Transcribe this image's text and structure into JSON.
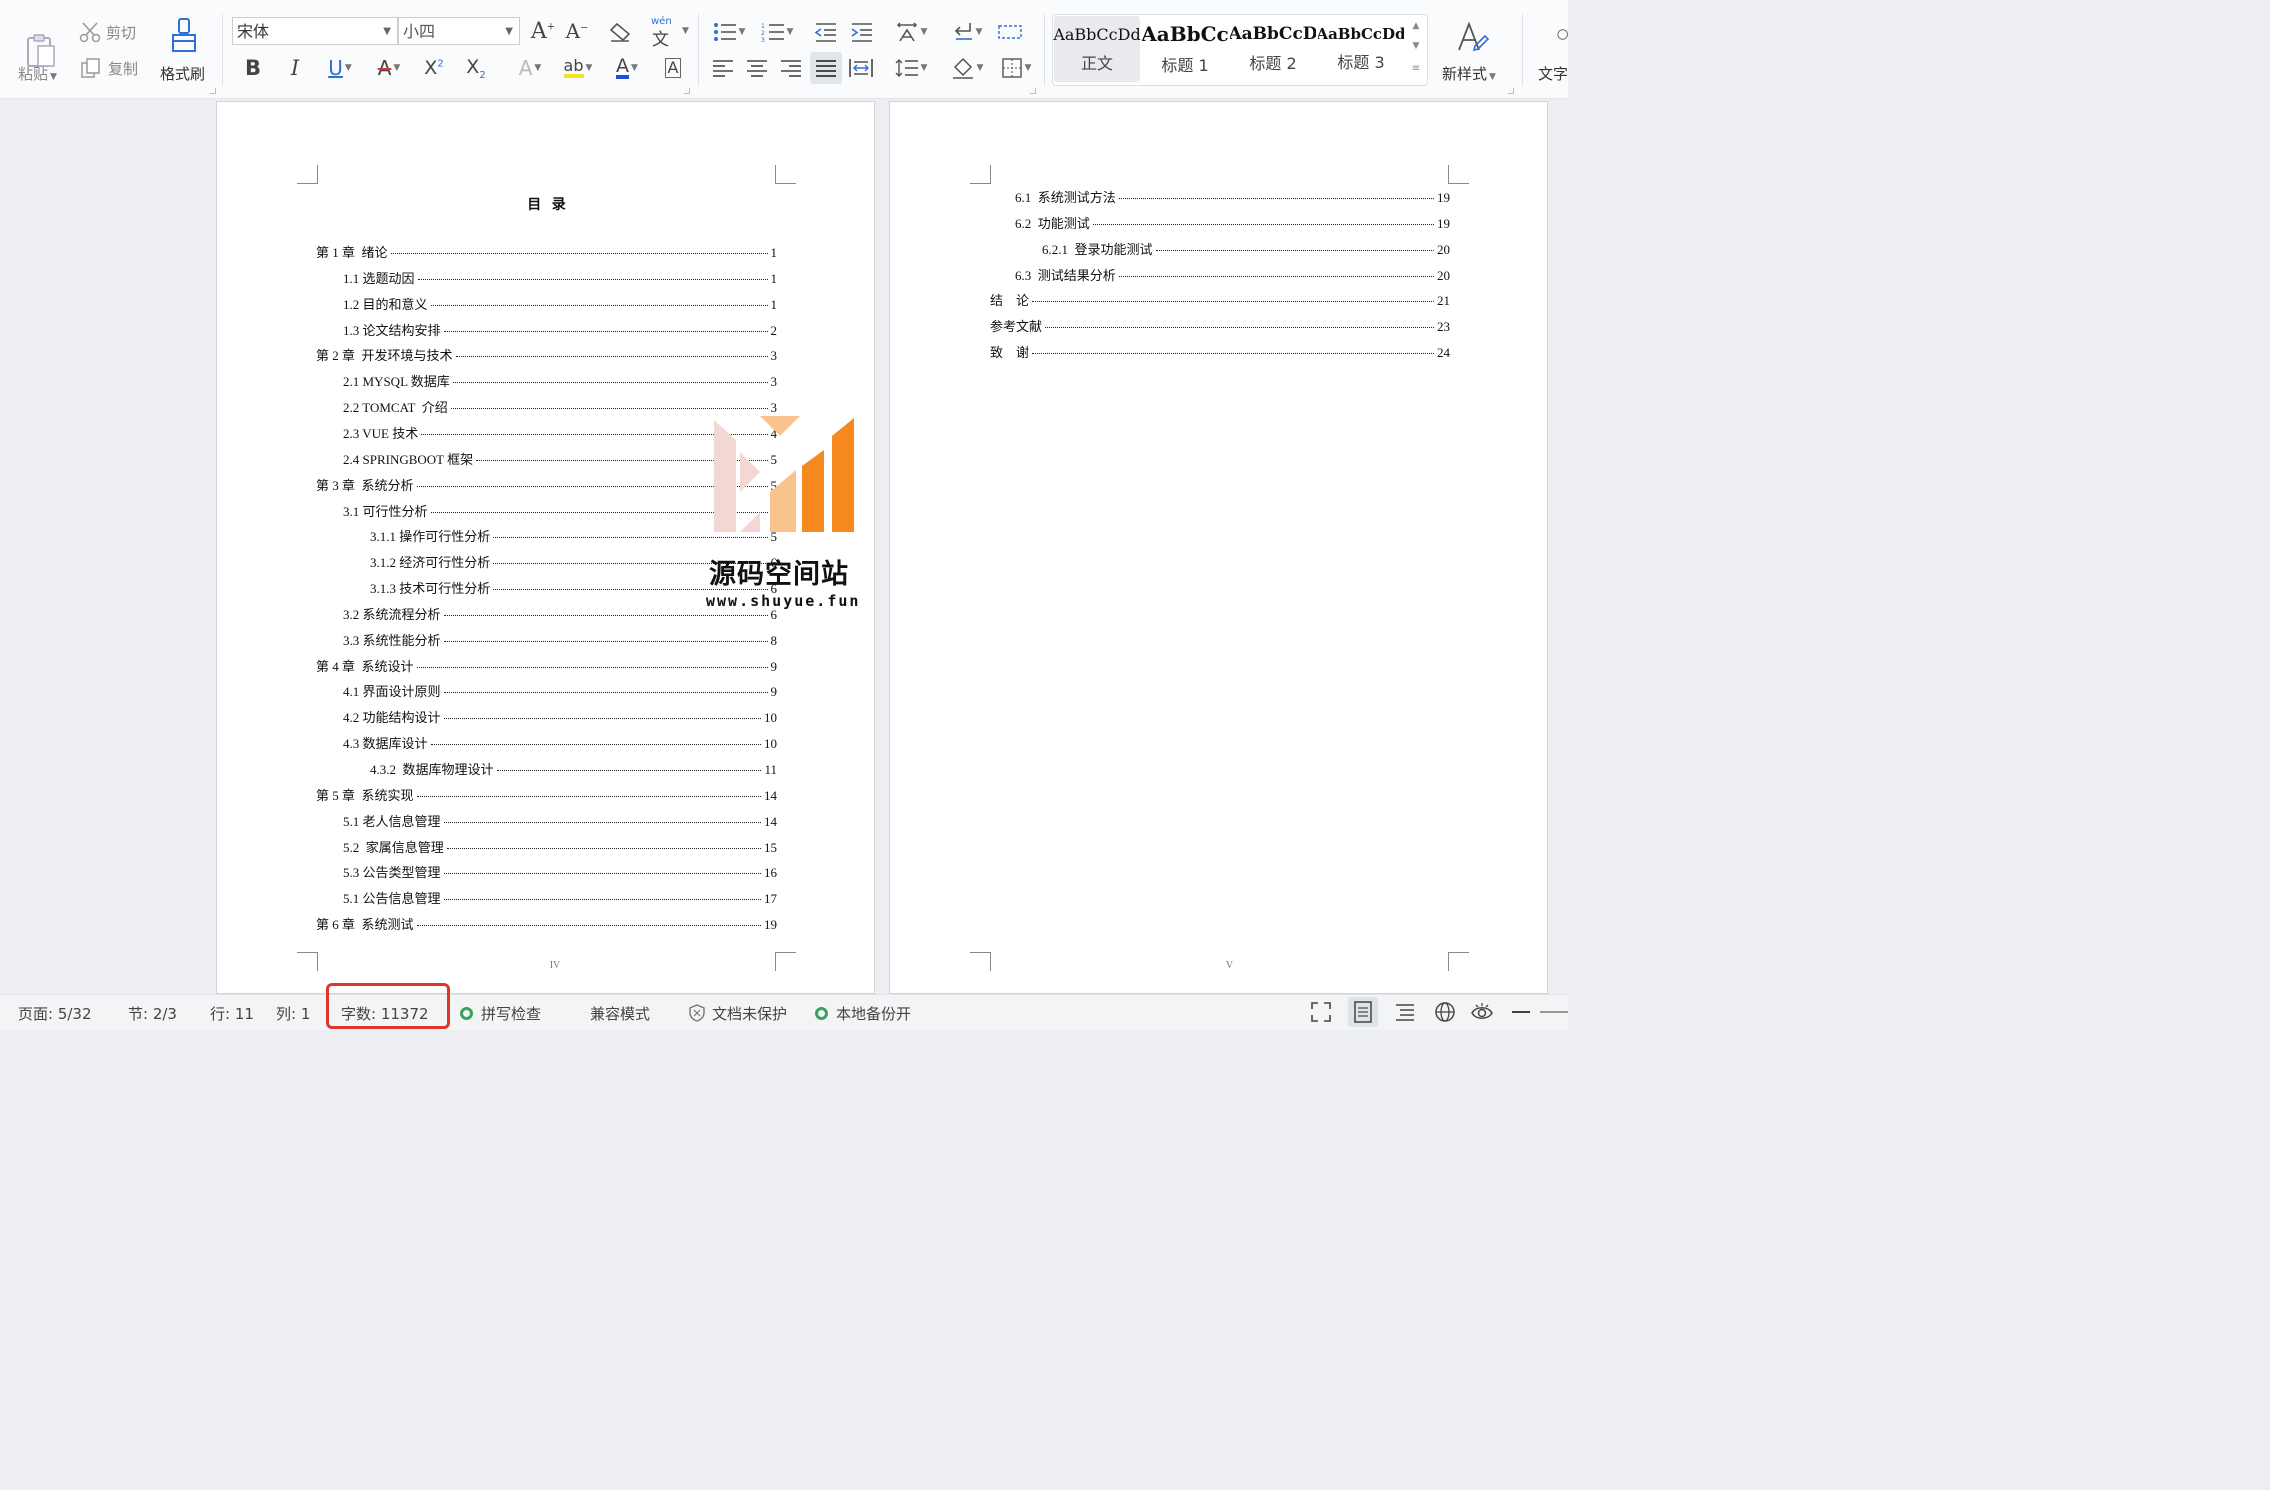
{
  "toolbar": {
    "paste": "粘贴",
    "cut": "剪切",
    "copy": "复制",
    "format_painter": "格式刷",
    "font_name": "宋体",
    "font_size": "小四",
    "wen_label": "wén",
    "style_normal_sample": "AaBbCcDd",
    "style_normal": "正文",
    "style_h1_sample": "AaBbCc",
    "style_h1": "标题 1",
    "style_h2_sample": "AaBbCcD",
    "style_h2": "标题 2",
    "style_h3_sample": "AaBbCcDd",
    "style_h3": "标题 3",
    "new_style": "新样式",
    "text_tool": "文字"
  },
  "page_left": {
    "heading": "目   录",
    "footer": "IV",
    "toc": [
      {
        "title": "第 1 章  绪论",
        "page": "1"
      },
      {
        "title": "1.1 选题动因",
        "page": "1"
      },
      {
        "title": "1.2 目的和意义",
        "page": "1"
      },
      {
        "title": "1.3 论文结构安排",
        "page": "2"
      },
      {
        "title": "第 2 章  开发环境与技术",
        "page": "3"
      },
      {
        "title": "2.1 MYSQL 数据库",
        "page": "3"
      },
      {
        "title": "2.2 TOMCAT  介绍",
        "page": "3"
      },
      {
        "title": "2.3 VUE 技术",
        "page": "4"
      },
      {
        "title": "2.4 SPRINGBOOT 框架",
        "page": "5"
      },
      {
        "title": "第 3 章  系统分析",
        "page": "5"
      },
      {
        "title": "3.1 可行性分析",
        "page": "5"
      },
      {
        "title": "3.1.1 操作可行性分析",
        "page": "5"
      },
      {
        "title": "3.1.2 经济可行性分析",
        "page": "6"
      },
      {
        "title": "3.1.3 技术可行性分析",
        "page": "6"
      },
      {
        "title": "3.2 系统流程分析",
        "page": "6"
      },
      {
        "title": "3.3 系统性能分析",
        "page": "8"
      },
      {
        "title": "第 4 章  系统设计",
        "page": "9"
      },
      {
        "title": "4.1 界面设计原则",
        "page": "9"
      },
      {
        "title": "4.2 功能结构设计",
        "page": "10"
      },
      {
        "title": "4.3 数据库设计",
        "page": "10"
      },
      {
        "title": "4.3.2  数据库物理设计",
        "page": "11"
      },
      {
        "title": "第 5 章  系统实现",
        "page": "14"
      },
      {
        "title": "5.1 老人信息管理",
        "page": "14"
      },
      {
        "title": "5.2  家属信息管理",
        "page": "15"
      },
      {
        "title": "5.3 公告类型管理",
        "page": "16"
      },
      {
        "title": "5.1 公告信息管理",
        "page": "17"
      },
      {
        "title": "第 6 章  系统测试",
        "page": "19"
      }
    ]
  },
  "page_right": {
    "footer": "V",
    "toc": [
      {
        "title": "6.1  系统测试方法",
        "page": "19"
      },
      {
        "title": "6.2  功能测试",
        "page": "19"
      },
      {
        "title": "6.2.1  登录功能测试",
        "page": "20"
      },
      {
        "title": "6.3  测试结果分析",
        "page": "20"
      },
      {
        "title": "结    论",
        "page": "21"
      },
      {
        "title": "参考文献",
        "page": "23"
      },
      {
        "title": "致    谢",
        "page": "24"
      }
    ]
  },
  "watermark": {
    "name": "源码空间站",
    "url": "www.shuyue.fun",
    "colors": {
      "orange": "#f5891f",
      "light_orange": "#f9c38e",
      "pink": "#f2d7d3"
    }
  },
  "statusbar": {
    "page": "页面: 5/32",
    "section": "节: 2/3",
    "row": "行: 11",
    "col": "列: 1",
    "word_count": "字数: 11372",
    "spell_check": "拼写检查",
    "compat_mode": "兼容模式",
    "doc_protect": "文档未保护",
    "local_backup": "本地备份开",
    "highlight_color": "#e0352b"
  }
}
